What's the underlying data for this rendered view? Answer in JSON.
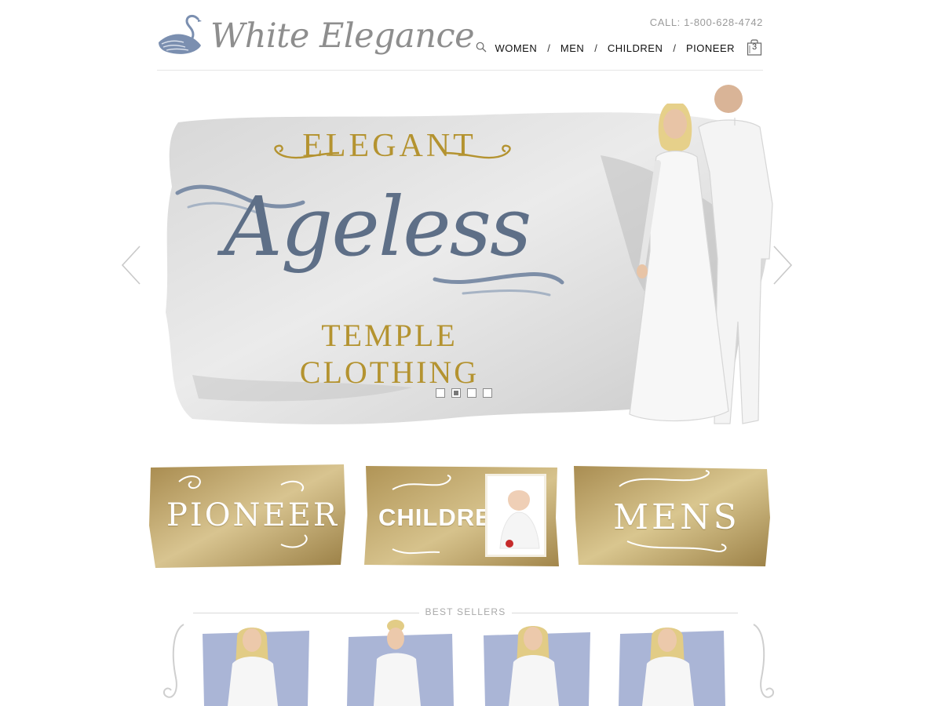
{
  "brand": {
    "name": "White Elegance",
    "logo_icon": "swan-icon",
    "text_color": "#8e8e8e",
    "swan_color": "#7b8fb0"
  },
  "header": {
    "phone": "CALL: 1-800-628-4742",
    "nav": [
      {
        "label": "WOMEN"
      },
      {
        "label": "MEN"
      },
      {
        "label": "CHILDREN"
      },
      {
        "label": "PIONEER"
      }
    ],
    "separator": "/",
    "search_icon": "search-icon",
    "cart_icon": "shopping-bag-icon",
    "cart_count": "3"
  },
  "hero": {
    "line1": "ELEGANT",
    "line2": "Ageless",
    "line3": "TEMPLE CLOTHING",
    "gold": "#b49330",
    "slate": "#5e6f87",
    "slides_total": 4,
    "active_slide": 2,
    "prev_icon": "chevron-left-icon",
    "next_icon": "chevron-right-icon"
  },
  "categories": [
    {
      "label": "PIONEER"
    },
    {
      "label": "CHILDREN"
    },
    {
      "label": "MENS"
    }
  ],
  "best_sellers": {
    "title": "BEST SELLERS",
    "product_count": 4,
    "wash_color": "#8d9cc8"
  }
}
